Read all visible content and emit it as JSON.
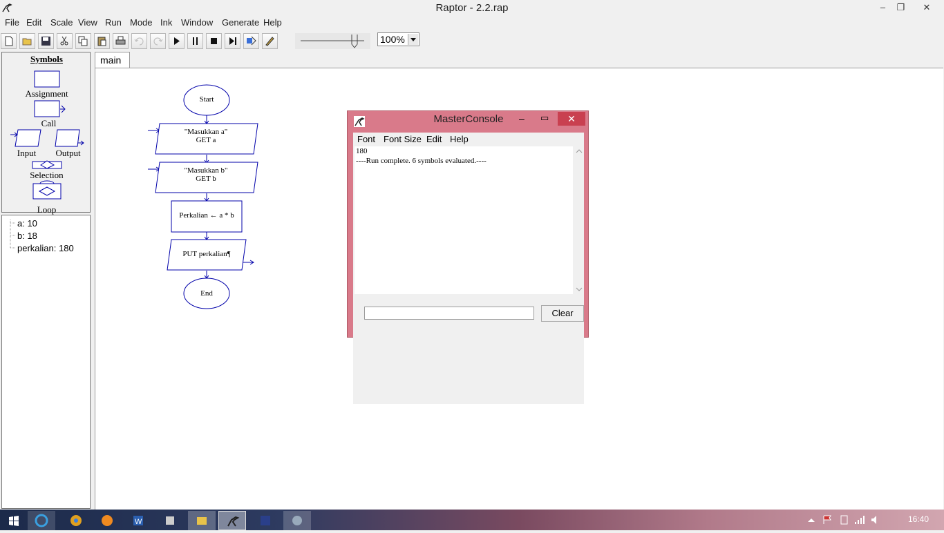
{
  "window": {
    "title": "Raptor - 2.2.rap",
    "min": "–",
    "max": "❐",
    "close": "✕"
  },
  "menu": [
    "File",
    "Edit",
    "Scale",
    "View",
    "Run",
    "Mode",
    "Ink",
    "Window",
    "Generate",
    "Help"
  ],
  "toolbar": {
    "zoom": "100%"
  },
  "symbols": {
    "title": "Symbols",
    "assignment": "Assignment",
    "call": "Call",
    "input": "Input",
    "output": "Output",
    "selection": "Selection",
    "loop": "Loop"
  },
  "variables": [
    "a: 10",
    "b: 18",
    "perkalian: 180"
  ],
  "tab": "main",
  "flowchart": {
    "start": "Start",
    "input1_line1": "\"Masukkan a\"",
    "input1_line2": "GET a",
    "input2_line1": "\"Masukkan b\"",
    "input2_line2": "GET b",
    "assign": "Perkalian ← a * b",
    "output": "PUT perkalian¶",
    "end": "End"
  },
  "console": {
    "title": "MasterConsole",
    "menu": [
      "Font",
      "Font Size",
      "Edit",
      "Help"
    ],
    "lines": [
      "180",
      "----Run complete.  6 symbols evaluated.----"
    ],
    "input_value": "",
    "clear": "Clear"
  },
  "taskbar": {
    "clock": "16:40"
  }
}
